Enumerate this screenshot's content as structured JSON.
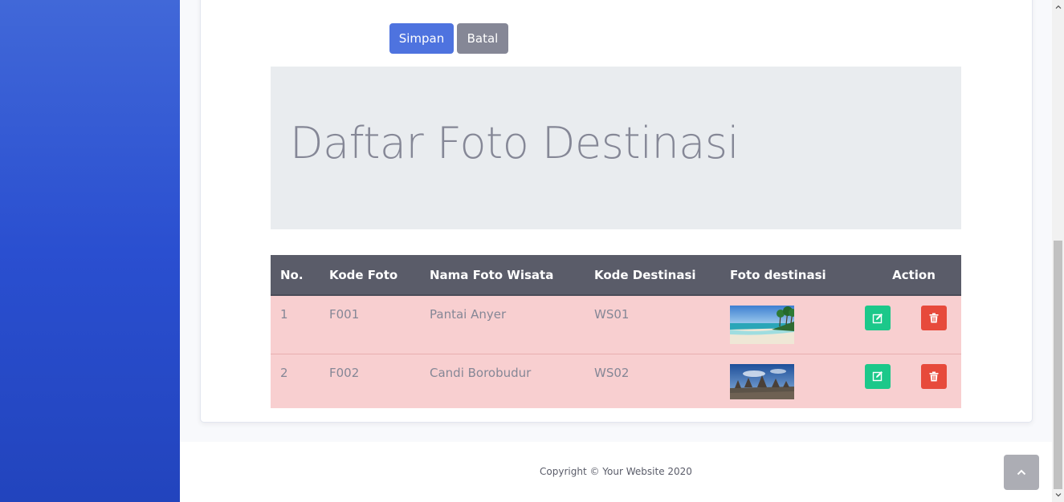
{
  "form": {
    "save_label": "Simpan",
    "cancel_label": "Batal"
  },
  "jumbotron": {
    "title": "Daftar Foto Destinasi"
  },
  "table": {
    "headers": [
      "No.",
      "Kode Foto",
      "Nama Foto Wisata",
      "Kode Destinasi",
      "Foto destinasi",
      "Action"
    ],
    "rows": [
      {
        "no": "1",
        "kode_foto": "F001",
        "nama": "Pantai Anyer",
        "kode_destinasi": "WS01",
        "image": "beach-photo"
      },
      {
        "no": "2",
        "kode_foto": "F002",
        "nama": "Candi Borobudur",
        "kode_destinasi": "WS02",
        "image": "temple-photo"
      }
    ]
  },
  "footer": {
    "copyright": "Copyright © Your Website 2020"
  },
  "icons": {
    "edit": "edit-icon",
    "delete": "trash-icon",
    "scroll_top": "chevron-up-icon"
  },
  "colors": {
    "primary": "#4e73df",
    "secondary": "#858796",
    "success": "#1cc88a",
    "danger": "#e74a3b",
    "row_bg": "#f8cfd0",
    "header_bg": "#5a5c69"
  }
}
